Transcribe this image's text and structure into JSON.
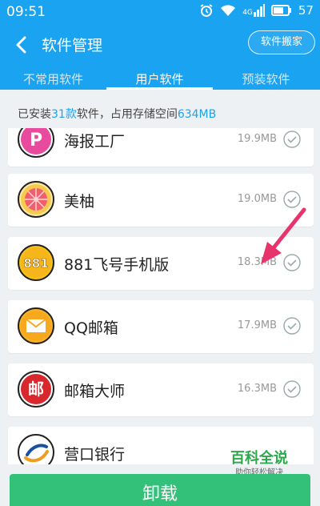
{
  "status_bar": {
    "time": "09:51",
    "network": "4G",
    "battery": "57"
  },
  "header": {
    "title": "软件管理",
    "move_button": "软件搬家"
  },
  "tabs": [
    {
      "label": "不常用软件"
    },
    {
      "label": "用户软件"
    },
    {
      "label": "预装软件"
    }
  ],
  "summary": {
    "prefix": "已安装",
    "count": "31款",
    "middle": "软件，占用存储空间",
    "size": "634MB"
  },
  "apps": [
    {
      "name": "海报工厂",
      "size": "19.9MB",
      "icon": "haibao-icon"
    },
    {
      "name": "美柚",
      "size": "19.0MB",
      "icon": "meiyou-icon"
    },
    {
      "name": "881飞号手机版",
      "size": "18.3MB",
      "icon": "feihao-881-icon"
    },
    {
      "name": "QQ邮箱",
      "size": "17.9MB",
      "icon": "qqmail-icon"
    },
    {
      "name": "邮箱大师",
      "size": "16.3MB",
      "icon": "mailmaster-icon"
    },
    {
      "name": "营口银行",
      "size": "",
      "icon": "yingkou-bank-icon"
    }
  ],
  "icon_glyphs": {
    "feihao": "881",
    "mailmaster": "邮",
    "haibao": "P"
  },
  "uninstall_button": "卸载",
  "watermark": {
    "title": "百科全说",
    "subtitle": "助你轻松解决"
  },
  "colors": {
    "primary": "#1aa3f0",
    "accent_green": "#33c17a",
    "arrow": "#e8336d"
  }
}
